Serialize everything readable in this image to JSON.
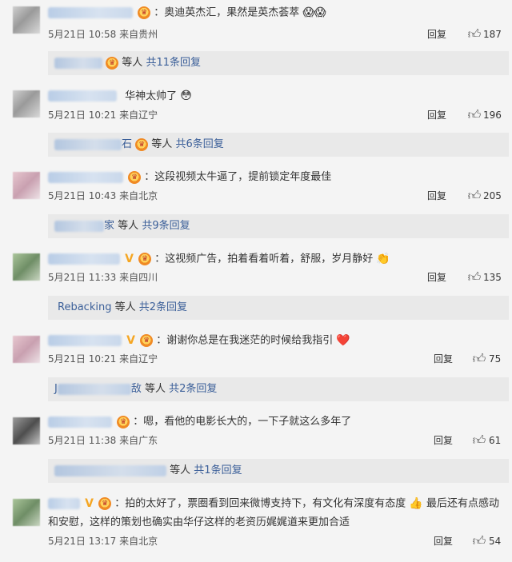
{
  "comments": [
    {
      "text": "：奥迪英杰汇，果然是英杰荟萃",
      "emoji": "😱😱",
      "date": "5月21日 10:58",
      "location": "来自贵州",
      "reply_label": "回复",
      "likes": "187",
      "sub": {
        "and": "等人",
        "link": "共11条回复"
      }
    },
    {
      "text": "华神太帅了",
      "emoji": "😳",
      "date": "5月21日 10:21",
      "location": "来自辽宁",
      "reply_label": "回复",
      "likes": "196",
      "sub": {
        "name": "石",
        "and": "等人",
        "link": "共6条回复"
      }
    },
    {
      "text": "：这段视频太牛逼了，提前锁定年度最佳",
      "date": "5月21日 10:43",
      "location": "来自北京",
      "reply_label": "回复",
      "likes": "205",
      "sub": {
        "name": "家",
        "and": "等人",
        "link": "共9条回复"
      }
    },
    {
      "text": "：这视频广告，拍着看着听着，舒服，岁月静好",
      "emoji": "👏",
      "date": "5月21日 11:33",
      "location": "来自四川",
      "reply_label": "回复",
      "likes": "135",
      "sub": {
        "name": "Rebacking",
        "and": "等人",
        "link": "共2条回复"
      }
    },
    {
      "text": "：谢谢你总是在我迷茫的时候给我指引",
      "emoji": "❤️",
      "date": "5月21日 10:21",
      "location": "来自辽宁",
      "reply_label": "回复",
      "likes": "75",
      "sub": {
        "name_prefix": "J",
        "name": "敌",
        "and": "等人",
        "link": "共2条回复"
      }
    },
    {
      "text": "：嗯，看他的电影长大的，一下子就这么多年了",
      "date": "5月21日 11:38",
      "location": "来自广东",
      "reply_label": "回复",
      "likes": "61",
      "sub": {
        "and": "等人",
        "link": "共1条回复"
      }
    },
    {
      "text": "：拍的太好了，票圈看到回来微博支持下，有文化有深度有态度",
      "emoji": "👍",
      "text_b": "最后还有点感动",
      "text2": "和安慰，这样的策划也确实由华仔这样的老资历娓娓道来更加合适",
      "date": "5月21日 13:17",
      "location": "来自北京",
      "reply_label": "回复",
      "likes": "54"
    }
  ],
  "colors": {
    "background": "#f4f4f4",
    "link": "#3b5f99",
    "sub_box": "#e9e9e9"
  },
  "icons": {
    "like": "thumbs-up-outline-icon",
    "badge": "crown-badge-icon",
    "verified": "verified-v-icon"
  }
}
